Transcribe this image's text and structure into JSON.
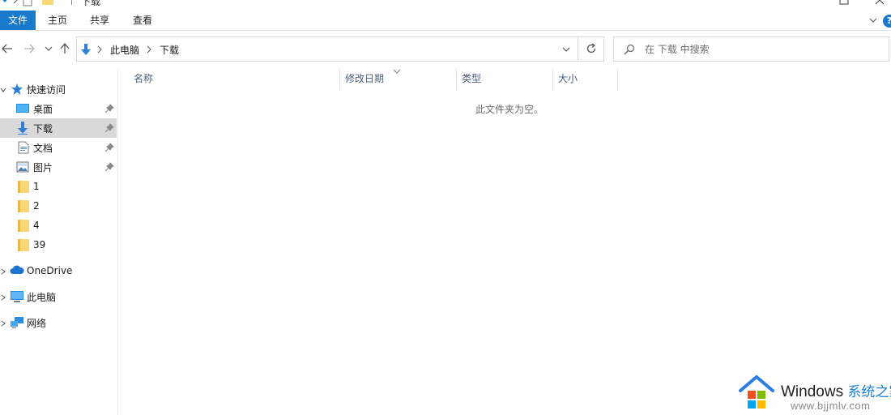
{
  "window": {
    "title": "下载"
  },
  "ribbon": {
    "tabs": [
      "文件",
      "主页",
      "共享",
      "查看"
    ],
    "active_tab": "文件",
    "help_label": "?",
    "accent_color": "#1979ca"
  },
  "navigation": {
    "back_icon": "back-arrow-icon",
    "forward_icon": "forward-arrow-icon",
    "recent_icon": "chevron-down-icon",
    "up_icon": "up-arrow-icon"
  },
  "address_bar": {
    "breadcrumb": [
      "此电脑",
      "下载"
    ],
    "location_icon": "downloads-arrow-icon",
    "dropdown_icon": "chevron-down-icon",
    "refresh_icon": "refresh-icon"
  },
  "search": {
    "placeholder": "在 下载 中搜索",
    "icon": "search-icon"
  },
  "sidebar": {
    "quick_access": {
      "label": "快速访问",
      "icon": "star-icon",
      "items": [
        {
          "label": "桌面",
          "icon": "desktop-icon",
          "pinned": true
        },
        {
          "label": "下载",
          "icon": "downloads-icon",
          "pinned": true,
          "selected": true
        },
        {
          "label": "文档",
          "icon": "documents-icon",
          "pinned": true
        },
        {
          "label": "图片",
          "icon": "pictures-icon",
          "pinned": true
        },
        {
          "label": "1",
          "icon": "folder-icon",
          "pinned": false
        },
        {
          "label": "2",
          "icon": "folder-icon",
          "pinned": false
        },
        {
          "label": "4",
          "icon": "folder-icon",
          "pinned": false
        },
        {
          "label": "39",
          "icon": "folder-icon",
          "pinned": false
        }
      ]
    },
    "roots": [
      {
        "label": "OneDrive",
        "icon": "cloud-icon"
      },
      {
        "label": "此电脑",
        "icon": "computer-icon"
      },
      {
        "label": "网络",
        "icon": "network-icon"
      }
    ]
  },
  "file_list": {
    "columns": [
      "名称",
      "修改日期",
      "类型",
      "大小"
    ],
    "sorted_column": "修改日期",
    "empty_message": "此文件夹为空。"
  },
  "watermark": {
    "brand": "Windows",
    "brand_cn": "系统之家",
    "url": "www.bjjmlv.com"
  }
}
